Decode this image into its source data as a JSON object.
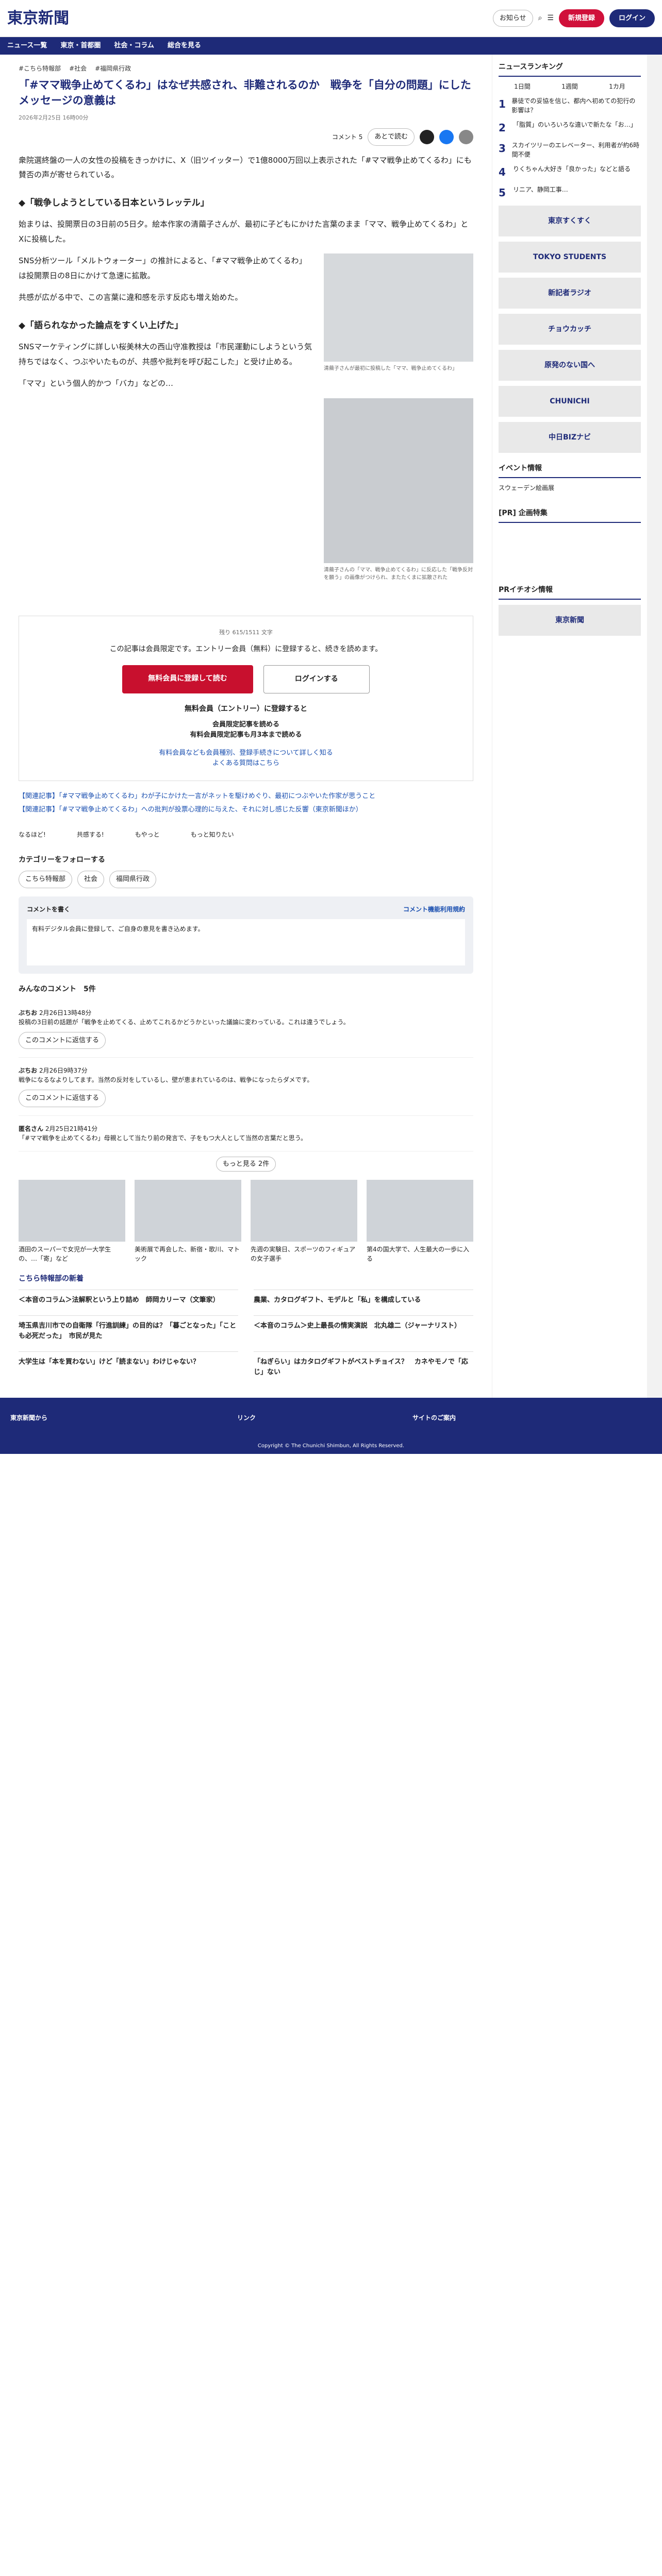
{
  "header": {
    "logo": "東京新聞",
    "notice": "お知らせ",
    "register": "新規登録",
    "login": "ログイン"
  },
  "nav": [
    "ニュース一覧",
    "東京・首都圏",
    "社会・コラム",
    "総合を見る"
  ],
  "tags": [
    "#こちら特報部",
    "#社会",
    "#福岡県行政"
  ],
  "title": "「#ママ戦争止めてくるわ」はなぜ共感され、非難されるのか　戦争を「自分の問題」にしたメッセージの意義は",
  "meta": "2026年2月25日 16時00分",
  "tool": {
    "comment": "コメント 5",
    "save": "あとで読む"
  },
  "p1": "衆院選終盤の一人の女性の投稿をきっかけに、X（旧ツイッター）で1億8000万回以上表示された「#ママ戦争止めてくるわ」にも賛否の声が寄せられている。",
  "h2a": "◆「戦争しようとしている日本というレッテル」",
  "p2": "始まりは、投開票日の3日前の5日夕。絵本作家の清繭子さんが、最初に子どもにかけた言葉のまま「ママ、戦争止めてくるわ」とXに投稿した。",
  "p3": "SNS分析ツール「メルトウォーター」の推計によると、「#ママ戦争止めてくるわ」は投開票日の8日にかけて急速に拡散。",
  "p4": "共感が広がる中で、この言葉に違和感を示す反応も増え始めた。",
  "h2b": "◆「語られなかった論点をすくい上げた」",
  "p5": "SNSマーケティングに詳しい桜美林大の西山守准教授は「市民運動にしようという気持ちではなく、つぶやいたものが、共感や批判を呼び起こした」と受け止める。",
  "p6": "「ママ」という個人的かつ「バカ」などの…",
  "fig1": "清繭子さんが最初に投稿した「ママ、戦争止めてくるわ」",
  "fig2": "清繭子さんの「ママ、戦争止めてくるわ」に反応した「戦争反対を願う」の画像がつけられ、またたくまに拡散された",
  "paywall": {
    "count": "残り 615/1511 文字",
    "msg": "この記事は会員限定です。エントリー会員（無料）に登録すると、続きを読めます。",
    "reg": "無料会員に登録して読む",
    "login": "ログインする",
    "sub": "無料会員（エントリー）に登録すると",
    "b1": "会員限定記事を読める",
    "b2": "有料会員限定記事も月3本まで読める",
    "more": "有料会員なども会員種別、登録手続きについて詳しく知る",
    "faq": "よくある質問はこちら"
  },
  "related": [
    "【関連記事】「#ママ戦争止めてくるわ」わが子にかけた一言がネットを駆けめぐり、最初につぶやいた作家が思うこと",
    "【関連記事】「#ママ戦争止めてくるわ」への批判が投票心理的に与えた、それに対し感じた反響（東京新聞ほか）"
  ],
  "reactions": [
    "なるほど!",
    "共感する!",
    "もやっと",
    "もっと知りたい"
  ],
  "follow": "カテゴリーをフォローする",
  "ftags": [
    "こちら特報部",
    "社会",
    "福岡県行政"
  ],
  "comments": {
    "write": "コメントを書く",
    "rule": "コメント機能利用規約",
    "input": "有料デジタル会員に登録して、ご自身の意見を書き込めます。",
    "mine": "みんなのコメント　5件",
    "list": [
      {
        "u": "ぶちお",
        "d": "2月26日13時48分",
        "t": "投稿の3日前の話題が「戦争を止めてくる、止めてこれるかどうかといった議論に変わっている。これは違うでしょう。"
      },
      {
        "u": "ぶちお",
        "d": "2月26日9時37分",
        "t": "戦争になるなよりしてます。当然の反対をしているし、壁が恵まれているのは、戦争になったらダメです。"
      },
      {
        "u": "匿名さん",
        "d": "2月25日21時41分",
        "t": "「#ママ戦争を止めてくるわ」母親として当たり前の発言で、子をもつ大人として当然の言葉だと思う。"
      }
    ],
    "more": "もっと見る 2件",
    "reply": "このコメントに返信する"
  },
  "thumbs": [
    "酒田のスーパーで女児が一大学生の、…「寄」など",
    "美術展で再会した、新宿・歌川、マトック",
    "先週の実験日、スポーツのフィギュアの女子選手",
    "第4の国大学で、人生最大の一歩に入る"
  ],
  "news_h": "こちら特報部の新着",
  "news": [
    "＜本音のコラム＞法解釈という上り詰め　師岡カリーマ（文筆家）",
    "農業、カタログギフト、モデルと「私」を構成している",
    "埼玉県吉川市での自衛隊「行進訓練」の目的は？「暮ごとなった」「ことも必死だった」　市民が見た",
    "＜本音のコラム＞史上最長の情実演説　北丸雄二（ジャーナリスト）",
    "大学生は「本を買わない」けど「読まない」わけじゃない？",
    "「ねぎらい」はカタログギフトがベストチョイス？　カネやモノで「応じ」ない　"
  ],
  "footer": {
    "c1": "東京新聞から",
    "c2": "リンク",
    "c3": "サイトのご案内",
    "copy": "Copyright © The Chunichi Shimbun, All Rights Reserved."
  },
  "side": {
    "rank_h": "ニュースランキング",
    "tabs": [
      "1日間",
      "1週間",
      "1カ月"
    ],
    "rank": [
      "暴徒での妥協を信じ、都内へ初めての犯行の影響は？",
      "「脂質」のいろいろな違いで新たな「お…」",
      "スカイツリーのエレベーター、利用者が約6時間不便",
      "りくちゃん大好き「良かった」などと語る",
      "リニア、静岡工事…"
    ],
    "ads": [
      "東京すくすく",
      "TOKYO STUDENTS",
      "新記者ラジオ",
      "チョウカッチ",
      "原発のない国へ",
      "CHUNICHI",
      "中日BIZナビ",
      "東京新聞"
    ],
    "event_h": "イベント情報",
    "event": "スウェーデン絵画展",
    "pr_h": "[PR] 企画特集",
    "pr2": "PRイチオシ情報"
  }
}
